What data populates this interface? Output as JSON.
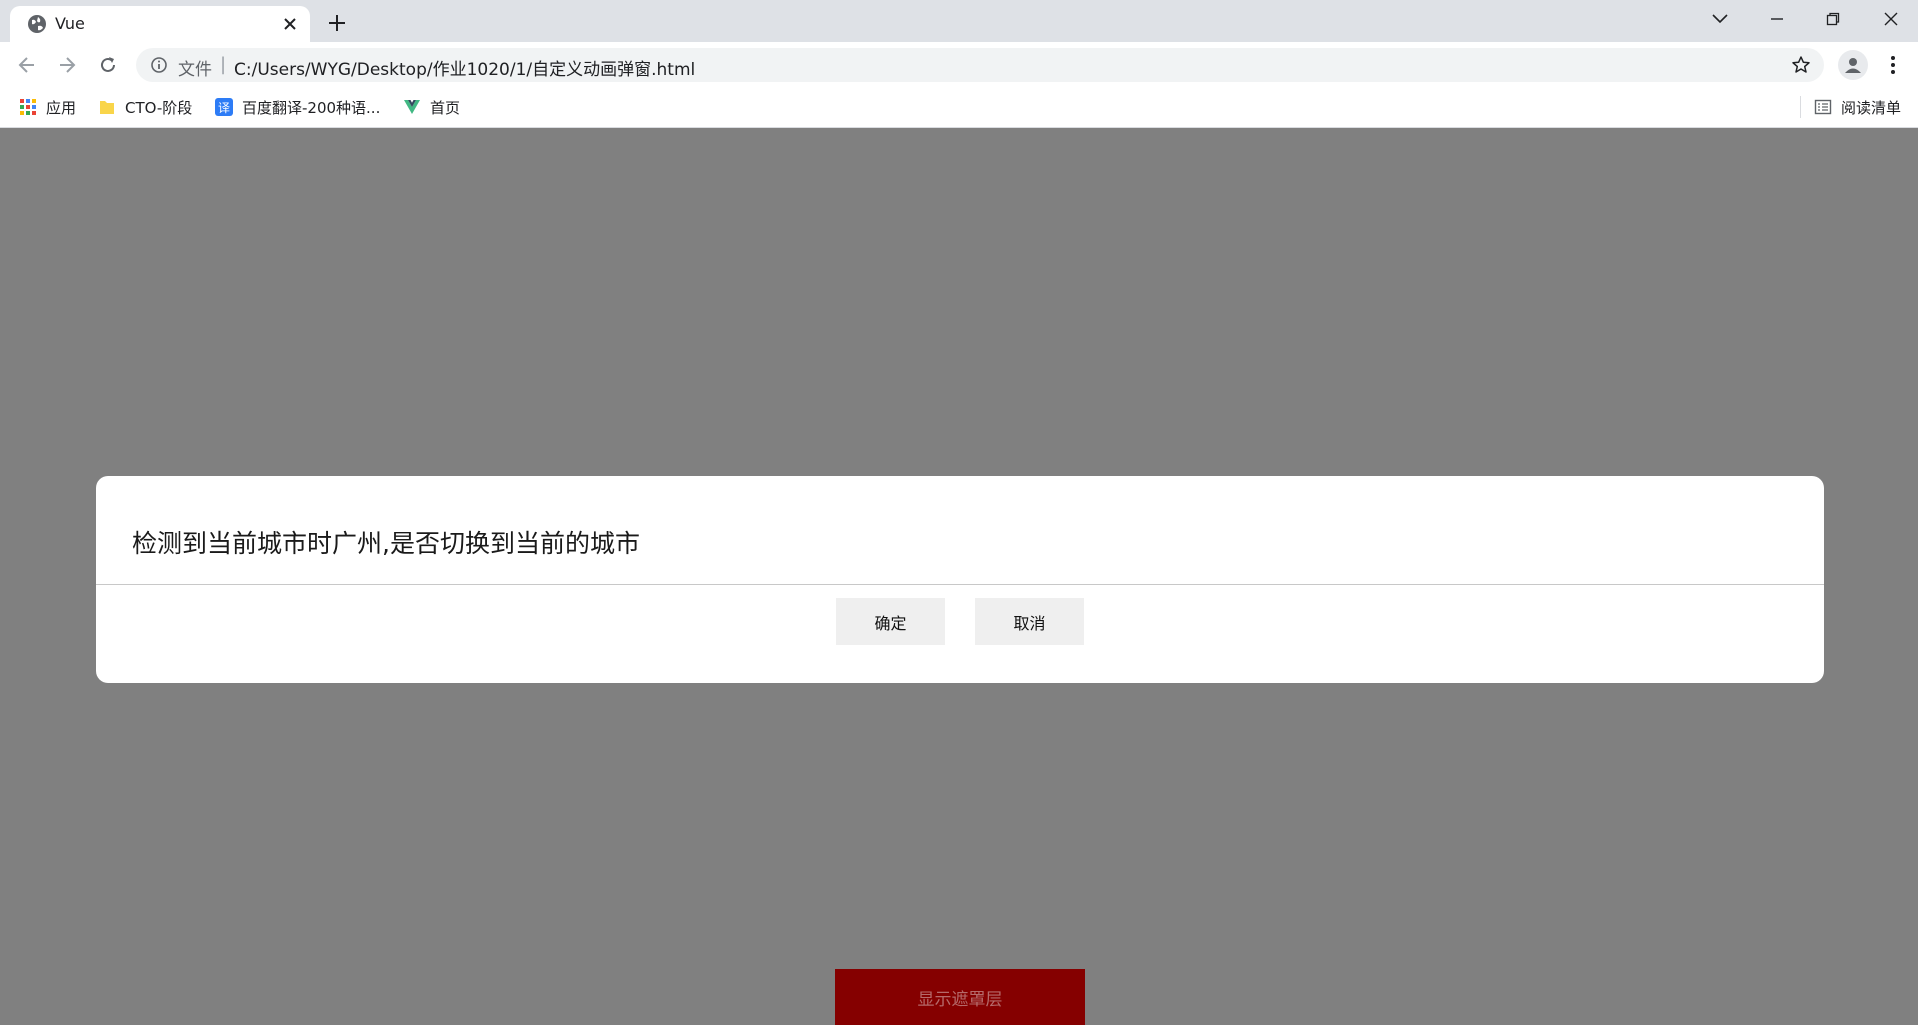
{
  "browser": {
    "tab": {
      "title": "Vue"
    },
    "address_bar": {
      "scheme_label": "文件",
      "separator": "|",
      "url": "C:/Users/WYG/Desktop/作业1020/1/自定义动画弹窗.html"
    },
    "bookmarks": [
      {
        "label": "应用",
        "icon": "apps-grid-icon"
      },
      {
        "label": "CTO-阶段",
        "icon": "folder-icon"
      },
      {
        "label": "百度翻译-200种语...",
        "icon": "translate-icon"
      },
      {
        "label": "首页",
        "icon": "vue-logo-icon"
      }
    ],
    "reading_list": {
      "label": "阅读清单",
      "icon": "reading-list-icon"
    }
  },
  "page": {
    "background_color": "#808080",
    "dialog": {
      "message": "检测到当前城市时广州,是否切换到当前的城市",
      "confirm_label": "确定",
      "cancel_label": "取消"
    },
    "show_mask_button": {
      "label": "显示遮罩层",
      "color": "#850000"
    }
  }
}
